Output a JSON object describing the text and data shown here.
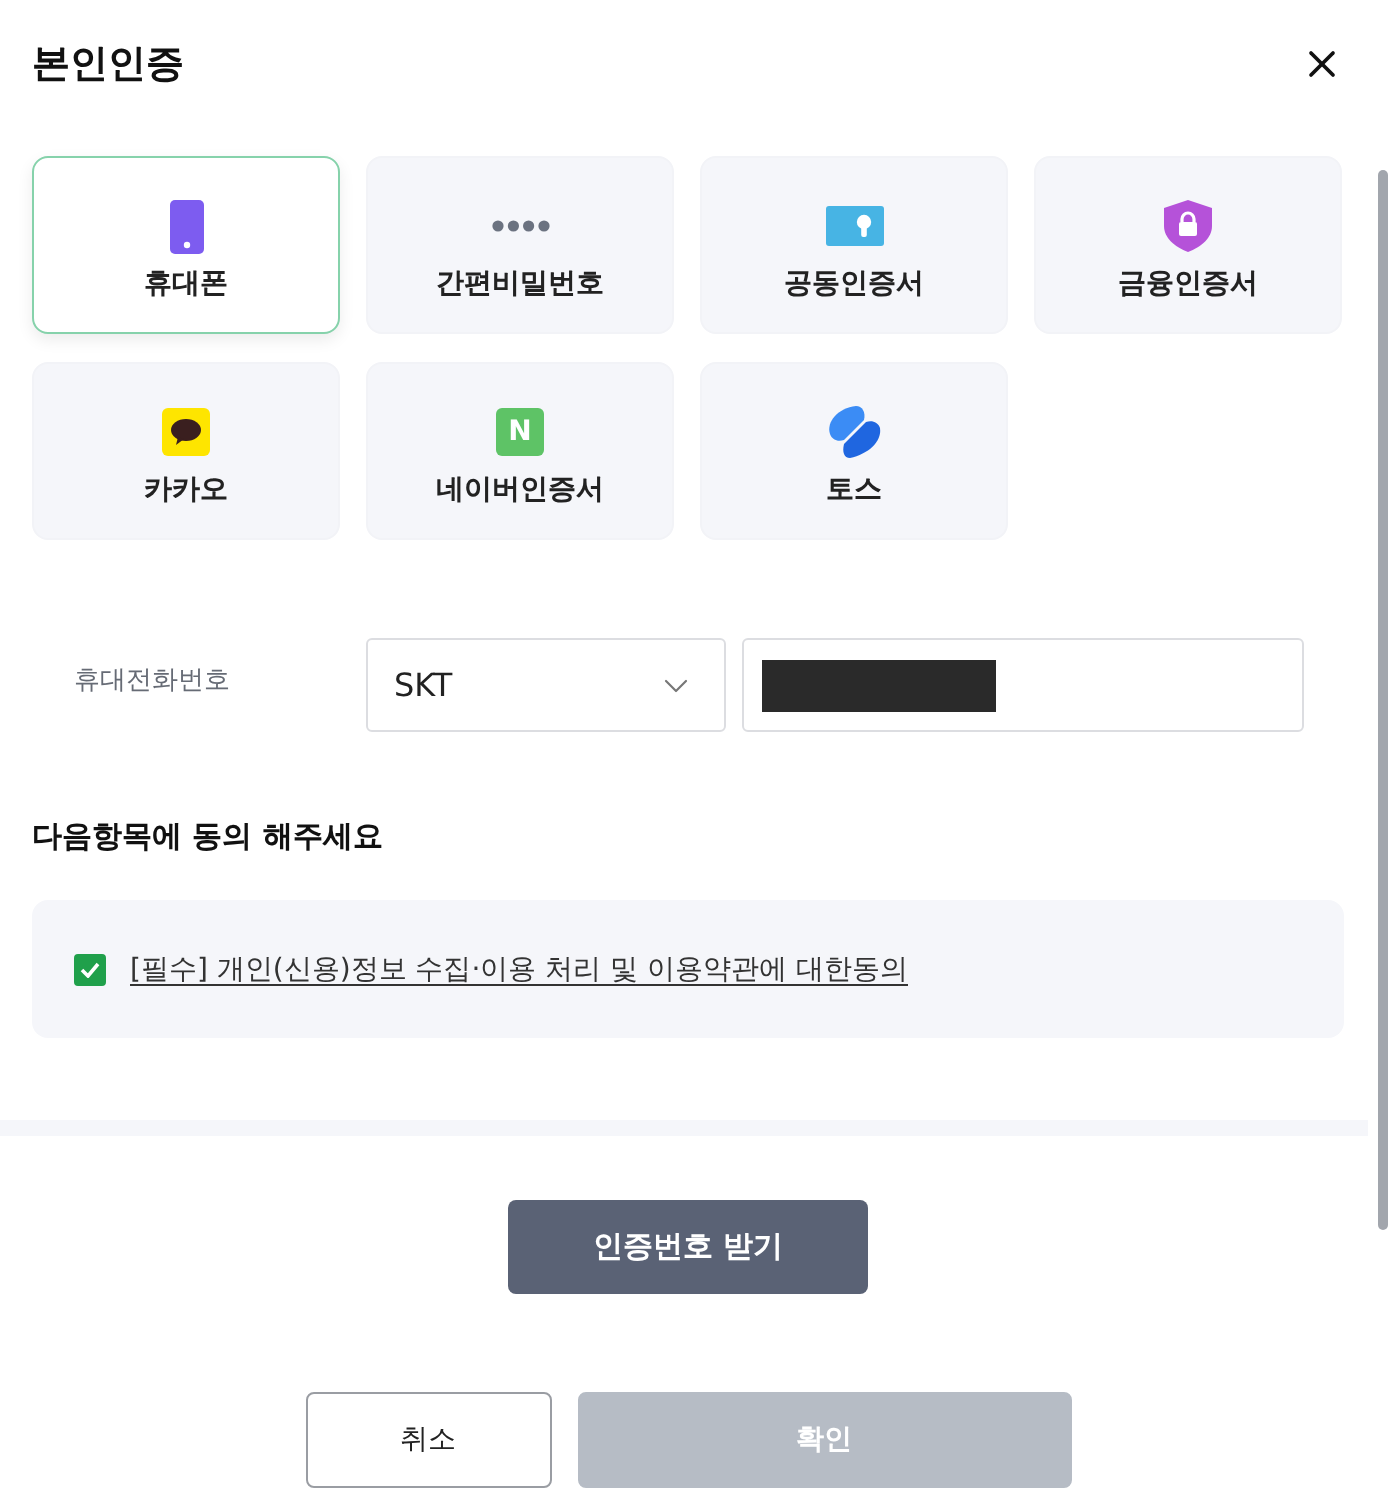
{
  "dialog": {
    "title": "본인인증"
  },
  "methods": [
    {
      "label": "휴대폰",
      "kind": "phone",
      "selected": true
    },
    {
      "label": "간편비밀번호",
      "kind": "pin",
      "selected": false
    },
    {
      "label": "공동인증서",
      "kind": "certificate",
      "selected": false
    },
    {
      "label": "금융인증서",
      "kind": "finance",
      "selected": false
    },
    {
      "label": "카카오",
      "kind": "kakao",
      "selected": false
    },
    {
      "label": "네이버인증서",
      "kind": "naver",
      "letter": "N",
      "selected": false
    },
    {
      "label": "토스",
      "kind": "toss",
      "selected": false
    }
  ],
  "phone": {
    "label": "휴대전화번호",
    "carrier": "SKT",
    "number_redacted": true
  },
  "agreement": {
    "heading": "다음항목에 동의 해주세요",
    "items": [
      {
        "text": "[필수] 개인(신용)정보 수집·이용 처리 및 이용약관에 대한동의",
        "checked": true
      }
    ]
  },
  "request_button": "인증번호 받기",
  "buttons": [
    {
      "label": "취소",
      "disabled": false
    },
    {
      "label": "확인",
      "disabled": true
    }
  ]
}
